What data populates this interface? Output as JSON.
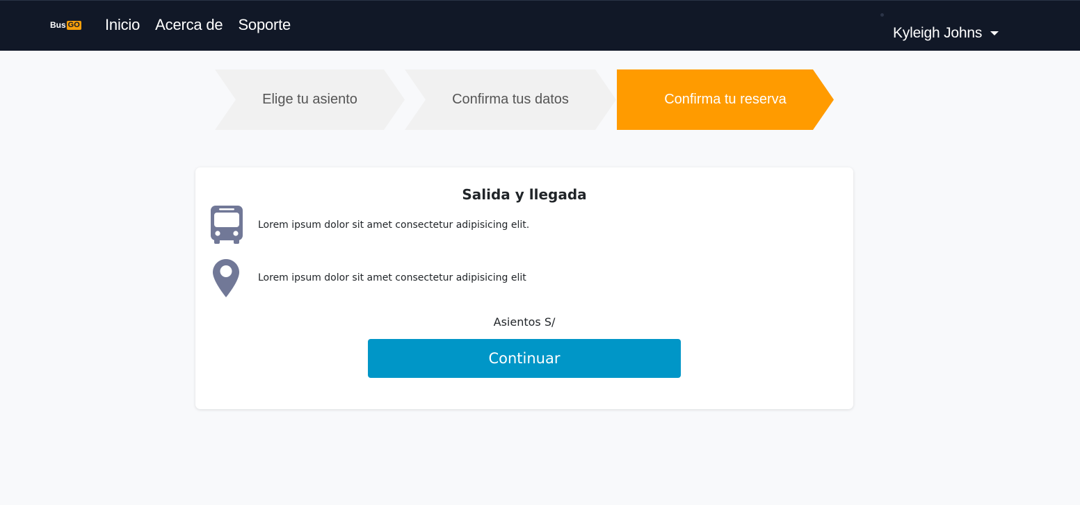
{
  "navbar": {
    "brand_text": "Bus",
    "brand_badge": "GO",
    "links": [
      "Inicio",
      "Acerca de",
      "Soporte"
    ],
    "user_name": "Kyleigh Johns"
  },
  "steps": [
    {
      "label": "Elige tu asiento",
      "active": false
    },
    {
      "label": "Confirma tus datos",
      "active": false
    },
    {
      "label": "Confirma tu reserva",
      "active": true
    }
  ],
  "card": {
    "title": "Salida y llegada",
    "departure_text": "Lorem ipsum dolor sit amet consectetur adipisicing elit.",
    "arrival_text": "Lorem ipsum dolor sit amet consectetur adipisicing elit",
    "seats_label": "Asientos S/",
    "continue_label": "Continuar"
  },
  "icons": {
    "departure": "bus-icon",
    "arrival": "map-pin-icon",
    "user_menu": "chevron-down-icon"
  },
  "colors": {
    "navbar": "#111827",
    "brand_accent": "#f59e0b",
    "active_step": "#ff9b00",
    "inactive_step": "#f1f1f1",
    "button": "#0096c7",
    "icon": "#717897"
  }
}
